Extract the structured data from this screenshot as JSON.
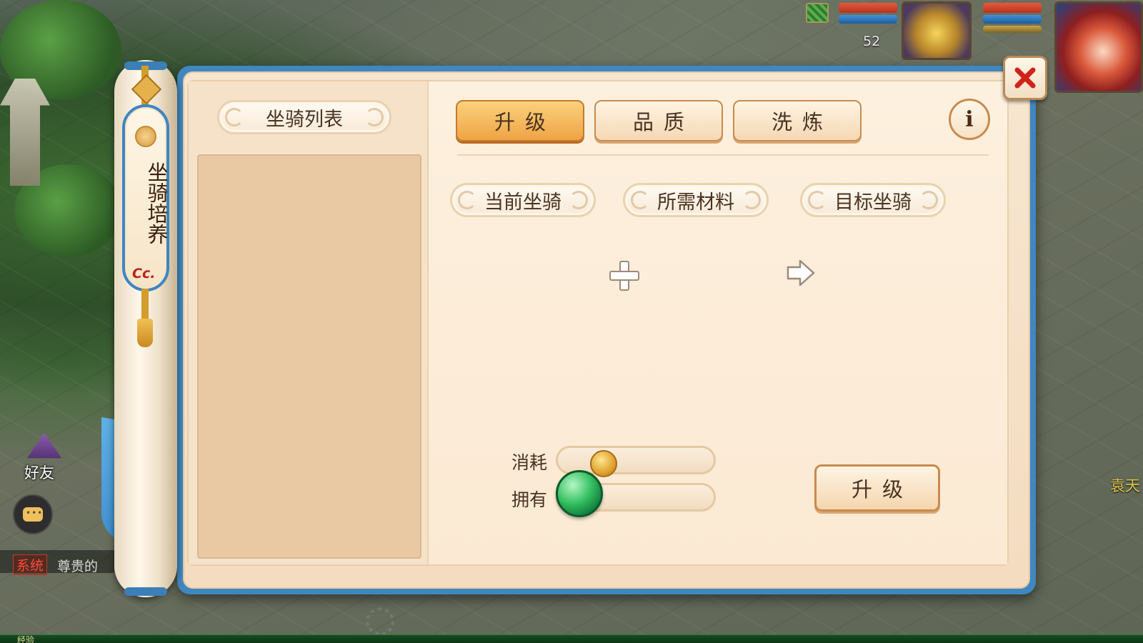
{
  "hud": {
    "level": "52"
  },
  "left_ui": {
    "friend_label": "好友",
    "system_tag": "系统",
    "system_message": "尊贵的",
    "right_name": "袁天"
  },
  "bottom": {
    "exp_label": "经验"
  },
  "scroll": {
    "title": "坐骑培养",
    "seal": "Cc."
  },
  "panel": {
    "list_title": "坐骑列表",
    "tabs": [
      {
        "label": "升级",
        "active": true
      },
      {
        "label": "品质",
        "active": false
      },
      {
        "label": "洗炼",
        "active": false
      }
    ],
    "info_label": "i",
    "sections": {
      "current": "当前坐骑",
      "materials": "所需材料",
      "target": "目标坐骑"
    },
    "cost": {
      "consume_label": "消耗",
      "own_label": "拥有",
      "consume_value": "",
      "own_value": ""
    },
    "upgrade_button": "升级"
  },
  "icons": {
    "close": "close-icon",
    "plus": "plus-icon",
    "arrow": "arrow-right-icon",
    "gold": "gold-coin-icon",
    "jade": "jade-dragon-coin-icon",
    "chat": "chat-icon",
    "gear": "gear-icon"
  },
  "colors": {
    "panel_border": "#3f87c1",
    "active_tab": "#eea444",
    "close_x": "#d0231c"
  }
}
